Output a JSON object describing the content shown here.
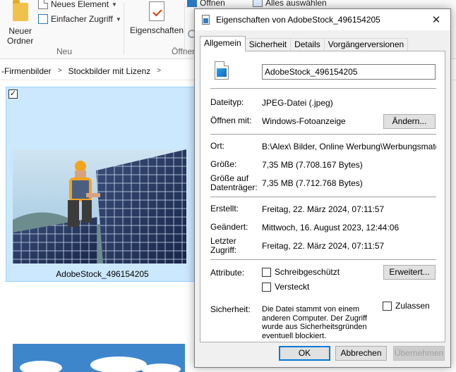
{
  "ribbon": {
    "new_folder_label_line1": "Neuer",
    "new_folder_label_line2": "Ordner",
    "new_element_label": "Neues Element",
    "easy_access_label": "Einfacher Zugriff",
    "properties_label": "Eigenschaften",
    "open_label": "Öffnen",
    "select_all_label": "Alles auswählen",
    "group_new_label": "Neu",
    "group_open_label": "Öffnen"
  },
  "address": {
    "crumbs": [
      "-Firmenbilder",
      "Stockbilder mit Lizenz"
    ]
  },
  "file_tile": {
    "name": "AdobeStock_496154205",
    "check_mark": "✓"
  },
  "dialog": {
    "title": "Eigenschaften von AdobeStock_496154205",
    "close_glyph": "✕",
    "tabs": [
      "Allgemein",
      "Sicherheit",
      "Details",
      "Vorgängerversionen"
    ],
    "active_tab": "Allgemein",
    "filename_value": "AdobeStock_496154205",
    "file_type_label": "Dateityp:",
    "file_type_value": "JPEG-Datei (.jpeg)",
    "opens_with_label": "Öffnen mit:",
    "opens_with_value": "Windows-Fotoanzeige",
    "change_button": "Ändern...",
    "location_label": "Ort:",
    "location_value": "B:\\Alex\\ Bilder, Online Werbung\\Werbungsmaterial-F",
    "size_label": "Größe:",
    "size_value": "7,35 MB (7.708.167 Bytes)",
    "size_on_disk_label_line1": "Größe auf",
    "size_on_disk_label_line2": "Datenträger:",
    "size_on_disk_value": "7,35 MB (7.712.768 Bytes)",
    "created_label": "Erstellt:",
    "created_value": "Freitag, 22. März 2024, 07:11:57",
    "modified_label": "Geändert:",
    "modified_value": "Mittwoch, 16. August 2023, 12:44:06",
    "accessed_label_line1": "Letzter",
    "accessed_label_line2": "Zugriff:",
    "accessed_value": "Freitag, 22. März 2024, 07:11:57",
    "attributes_label": "Attribute:",
    "readonly_label": "Schreibgeschützt",
    "hidden_label": "Versteckt",
    "advanced_button": "Erweitert...",
    "security_label": "Sicherheit:",
    "security_text": "Die Datei stammt von einem anderen Computer. Der Zugriff wurde aus Sicherheitsgründen eventuell blockiert.",
    "unblock_label": "Zulassen",
    "ok_button": "OK",
    "cancel_button": "Abbrechen",
    "apply_button": "Übernehmen"
  },
  "colors": {
    "selection_bg": "#cce8ff",
    "selection_border": "#99d1ff",
    "dialog_bg": "#f0f0f0",
    "accent": "#0078d7"
  }
}
